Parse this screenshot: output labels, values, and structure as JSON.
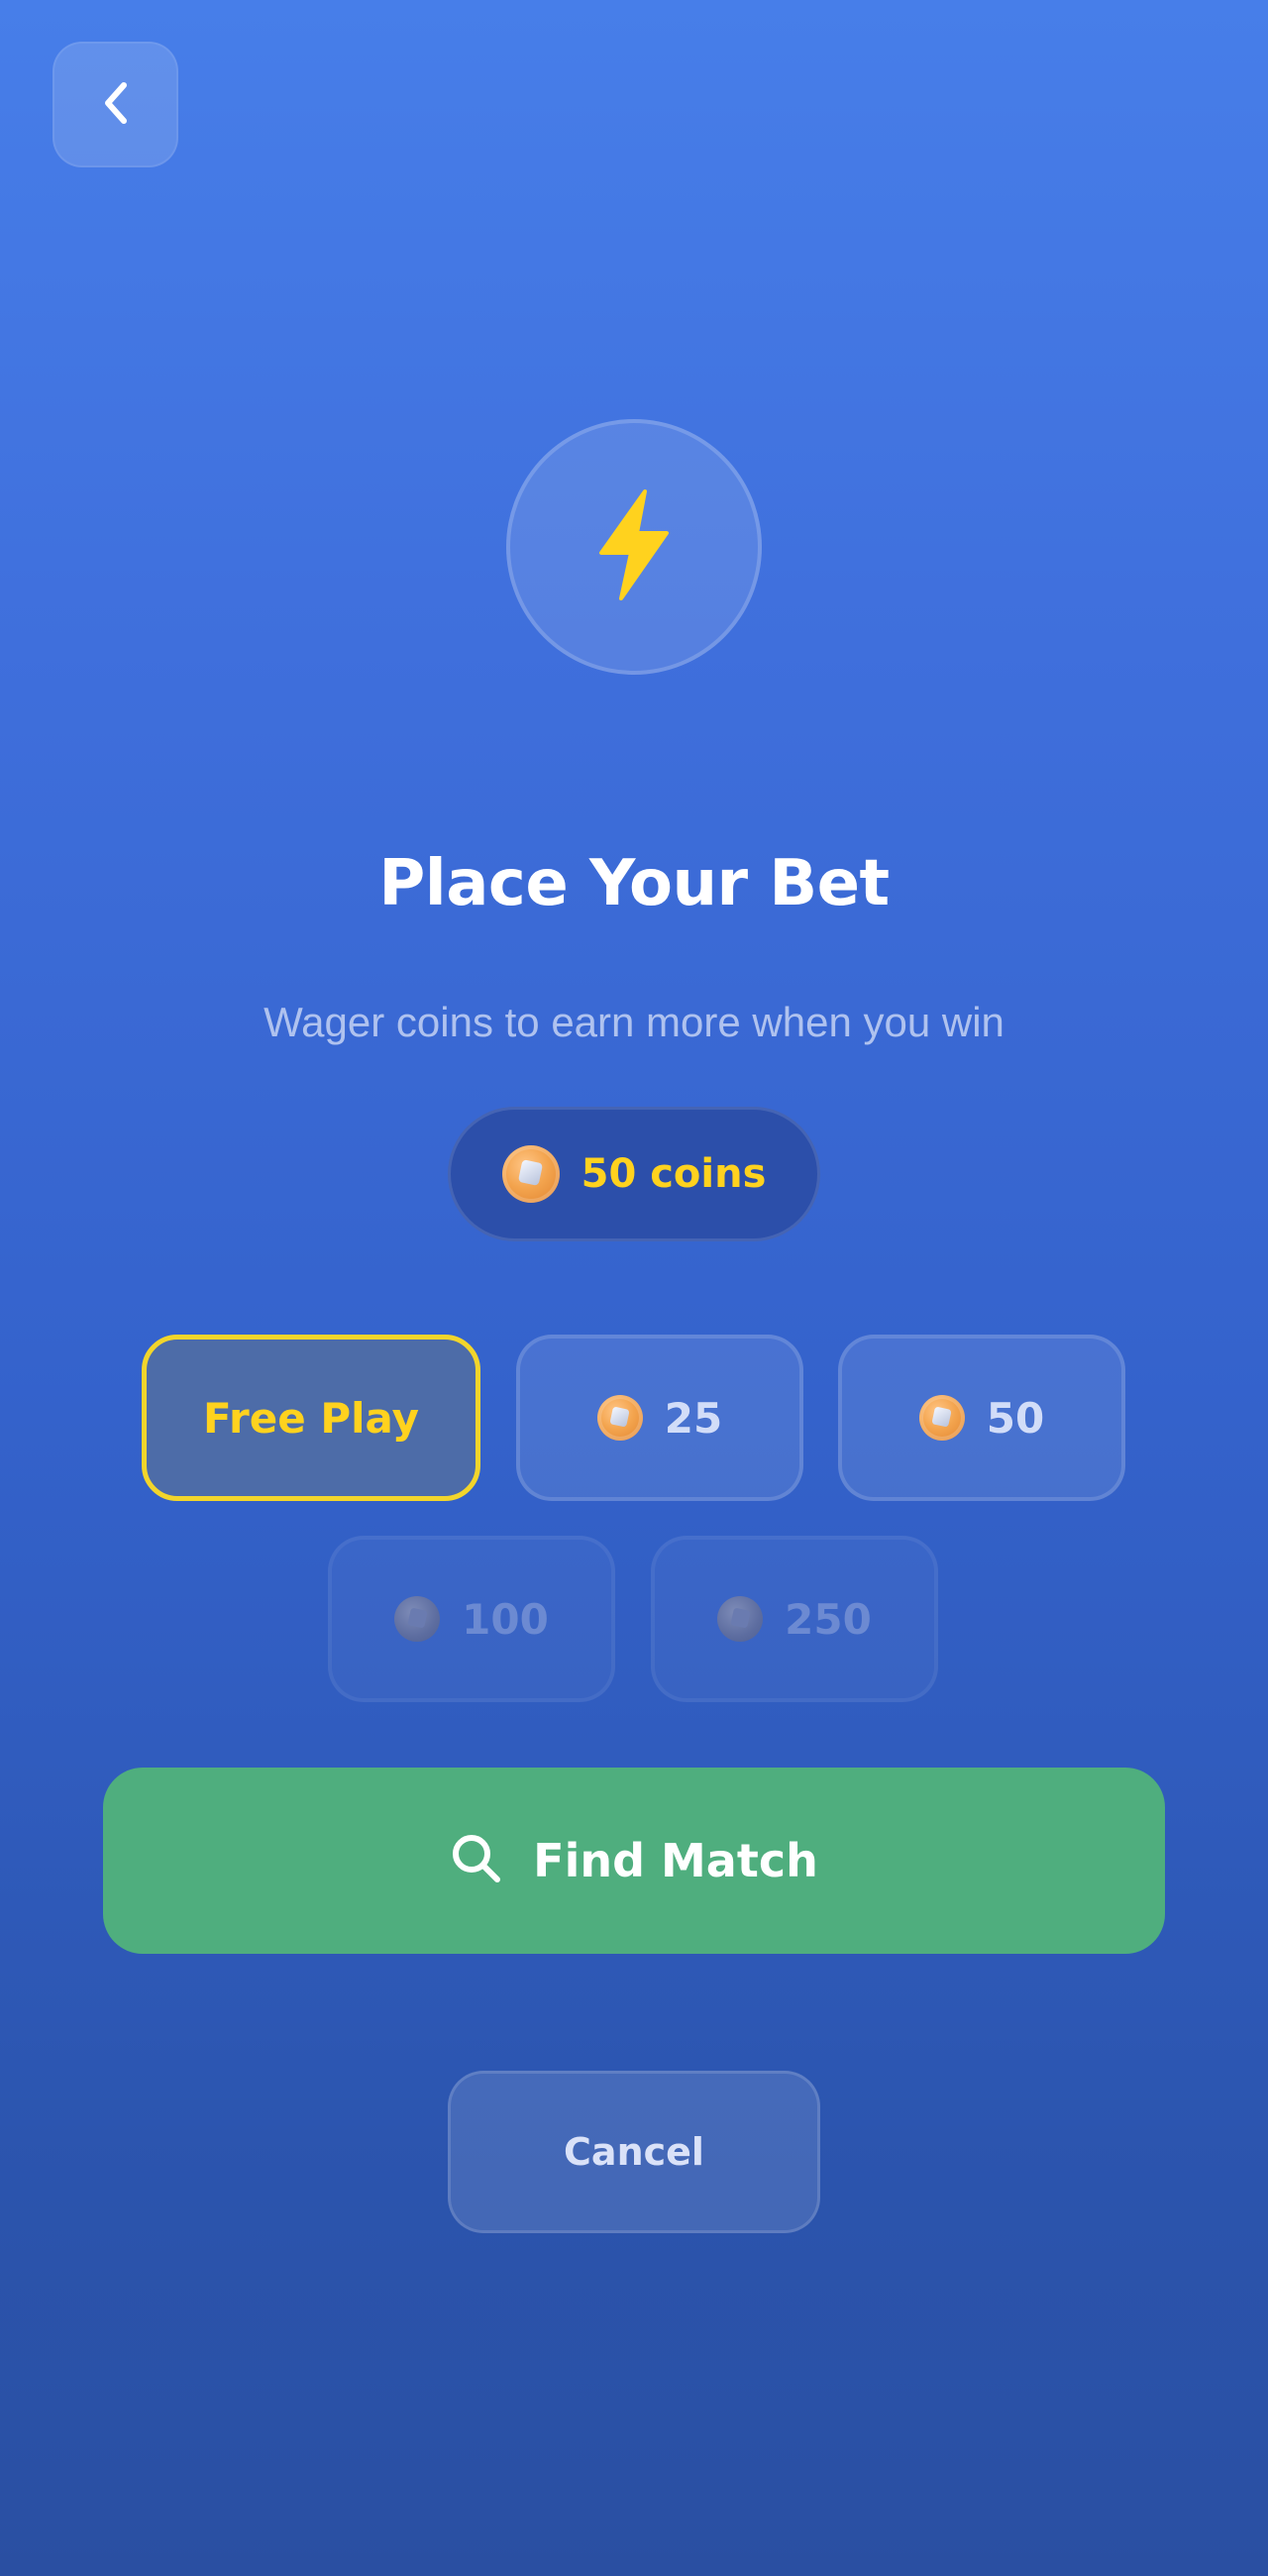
{
  "header": {
    "back_icon": "chevron-left-icon"
  },
  "hero": {
    "icon": "lightning-bolt-icon",
    "icon_color": "#ffd21e"
  },
  "title": "Place Your Bet",
  "subtitle": "Wager coins to earn more when you win",
  "balance": {
    "icon": "coin-icon",
    "label": "50 coins"
  },
  "bet_options": [
    {
      "label": "Free Play",
      "has_coin": false,
      "state": "selected"
    },
    {
      "label": "25",
      "has_coin": true,
      "state": "available"
    },
    {
      "label": "50",
      "has_coin": true,
      "state": "available"
    },
    {
      "label": "100",
      "has_coin": true,
      "state": "disabled"
    },
    {
      "label": "250",
      "has_coin": true,
      "state": "disabled"
    }
  ],
  "actions": {
    "find_match_label": "Find Match",
    "find_match_icon": "search-icon",
    "cancel_label": "Cancel"
  },
  "colors": {
    "accent_yellow": "#ffd21e",
    "find_match_green": "#4fae7e",
    "selected_border": "#f2d52b"
  }
}
